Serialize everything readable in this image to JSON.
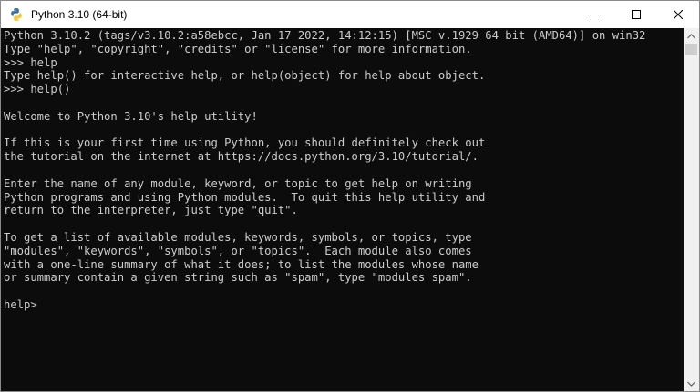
{
  "window": {
    "title": "Python 3.10 (64-bit)",
    "icon": "python-icon"
  },
  "caption_buttons": {
    "minimize_icon": "minimize-icon",
    "maximize_icon": "maximize-icon",
    "close_icon": "close-icon"
  },
  "console": {
    "lines": [
      "Python 3.10.2 (tags/v3.10.2:a58ebcc, Jan 17 2022, 14:12:15) [MSC v.1929 64 bit (AMD64)] on win32",
      "Type \"help\", \"copyright\", \"credits\" or \"license\" for more information.",
      ">>> help",
      "Type help() for interactive help, or help(object) for help about object.",
      ">>> help()",
      "",
      "Welcome to Python 3.10's help utility!",
      "",
      "If this is your first time using Python, you should definitely check out",
      "the tutorial on the internet at https://docs.python.org/3.10/tutorial/.",
      "",
      "Enter the name of any module, keyword, or topic to get help on writing",
      "Python programs and using Python modules.  To quit this help utility and",
      "return to the interpreter, just type \"quit\".",
      "",
      "To get a list of available modules, keywords, symbols, or topics, type",
      "\"modules\", \"keywords\", \"symbols\", or \"topics\".  Each module also comes",
      "with a one-line summary of what it does; to list the modules whose name",
      "or summary contain a given string such as \"spam\", type \"modules spam\".",
      "",
      "help> "
    ]
  },
  "scrollbar": {
    "up_icon": "scroll-up-arrow-icon",
    "down_icon": "scroll-down-arrow-icon"
  },
  "colors": {
    "console_background": "#0c0c0c",
    "console_text": "#cccccc",
    "titlebar_background": "#ffffff",
    "scrollbar_track": "#f0f0f0"
  }
}
